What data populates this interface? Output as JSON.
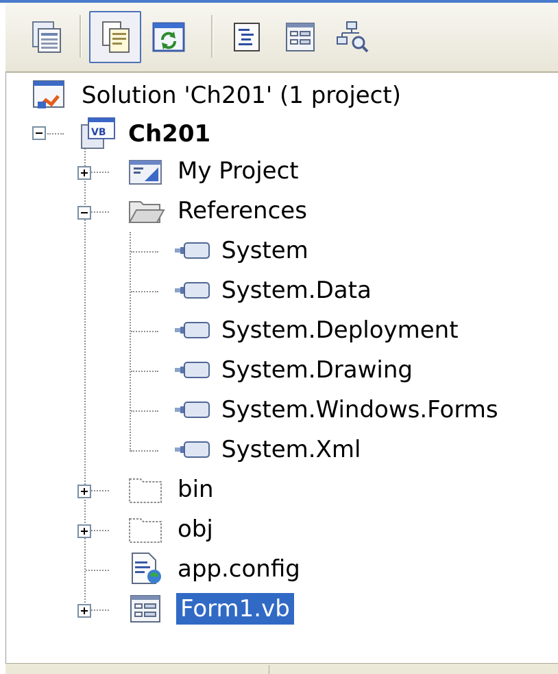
{
  "toolbar": {
    "buttons": [
      {
        "icon": "properties-icon",
        "tooltip": ""
      },
      {
        "icon": "show-all-files-icon",
        "active": true
      },
      {
        "icon": "refresh-icon"
      },
      {
        "icon": "view-code-icon"
      },
      {
        "icon": "view-designer-icon"
      },
      {
        "icon": "view-class-diagram-icon"
      }
    ]
  },
  "tree": {
    "solution": "Solution 'Ch201' (1 project)",
    "project": "Ch201",
    "my_project": "My Project",
    "references": "References",
    "refs": [
      "System",
      "System.Data",
      "System.Deployment",
      "System.Drawing",
      "System.Windows.Forms",
      "System.Xml"
    ],
    "bin": "bin",
    "obj": "obj",
    "app_config": "app.config",
    "form1": "Form1.vb"
  },
  "colors": {
    "selection": "#316ac5",
    "toolbar_active_border": "#4e72b8",
    "title_border": "#4a7bcc"
  }
}
